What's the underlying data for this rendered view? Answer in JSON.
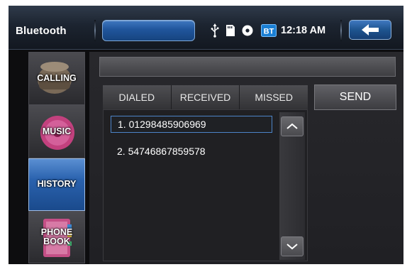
{
  "header": {
    "title": "Bluetooth",
    "time": "12:18 AM",
    "status_icons": [
      "usb-icon",
      "sd-card-icon",
      "disc-icon",
      "bluetooth-icon"
    ],
    "bt_badge": "BT",
    "back_icon": "back-arrow-icon"
  },
  "sidebar": {
    "items": [
      {
        "label": "CALLING",
        "icon": "phone-handset-icon",
        "active": false
      },
      {
        "label": "MUSIC",
        "icon": "music-disc-icon",
        "active": false
      },
      {
        "label": "HISTORY",
        "icon": "",
        "active": true
      },
      {
        "label": "PHONE BOOK",
        "icon": "phonebook-icon",
        "active": false
      }
    ]
  },
  "tabs": [
    {
      "label": "DIALED",
      "selected": true
    },
    {
      "label": "RECEIVED",
      "selected": false
    },
    {
      "label": "MISSED",
      "selected": false
    }
  ],
  "send_label": "SEND",
  "history_list": [
    {
      "text": "1. 01298485906969",
      "selected": true
    },
    {
      "text": "2. 54746867859578",
      "selected": false
    }
  ],
  "colors": {
    "accent_blue": "#2a62ae",
    "selection_border": "#4d84c8",
    "background": "#202023"
  }
}
